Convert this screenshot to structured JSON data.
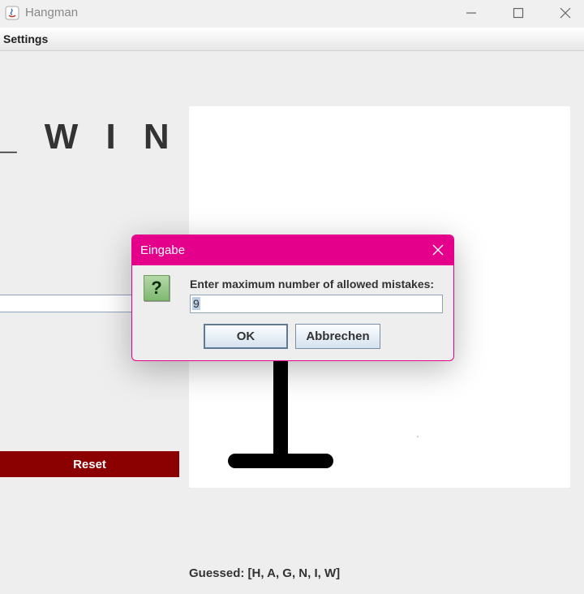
{
  "window": {
    "title": "Hangman",
    "icon": "java-app-icon"
  },
  "menu": {
    "items": [
      "Settings"
    ]
  },
  "game": {
    "word_display": "_ W I N G",
    "guess_input_value": "",
    "reset_label": "Reset",
    "guessed_text": "Guessed: [H, A, G, N, I, W]"
  },
  "dialog": {
    "title": "Eingabe",
    "icon": "question-icon",
    "message": "Enter maximum number of allowed mistakes:",
    "input_value": "9",
    "ok_label": "OK",
    "cancel_label": "Abbrechen"
  },
  "colors": {
    "reset_bg": "#8b0000",
    "dialog_accent": "#e4008a"
  }
}
